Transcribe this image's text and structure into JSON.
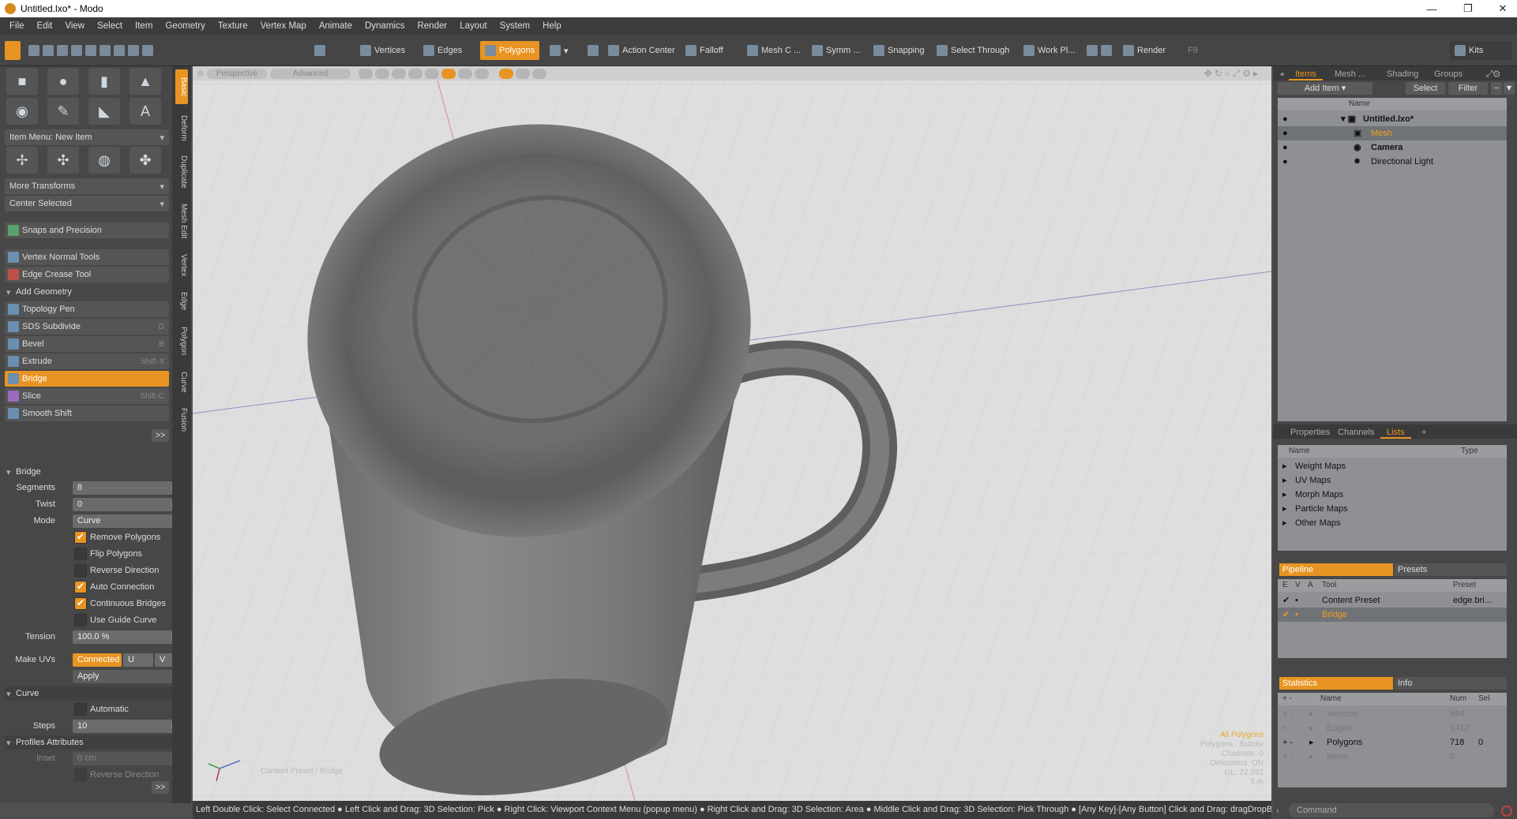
{
  "window": {
    "title": "Untitled.lxo* - Modo"
  },
  "menu": [
    "File",
    "Edit",
    "View",
    "Select",
    "Item",
    "Geometry",
    "Texture",
    "Vertex Map",
    "Animate",
    "Dynamics",
    "Render",
    "Layout",
    "System",
    "Help"
  ],
  "toolbar": {
    "vertices": "Vertices",
    "edges": "Edges",
    "polygons": "Polygons",
    "action_center": "Action Center",
    "falloff": "Falloff",
    "mesh_c": "Mesh C ...",
    "symm": "Symm ...",
    "snapping": "Snapping",
    "select_through": "Select Through",
    "work_pl": "Work Pl...",
    "render": "Render",
    "render_key": "F9",
    "kits": "Kits"
  },
  "left": {
    "item_menu": "Item Menu: New Item",
    "more_transforms": "More Transforms",
    "center_selected": "Center Selected",
    "snaps": "Snaps and Precision",
    "vertex_normal": "Vertex Normal Tools",
    "edge_crease": "Edge Crease Tool",
    "add_geometry": "Add Geometry",
    "tools": [
      {
        "label": "Topology Pen",
        "key": ""
      },
      {
        "label": "SDS Subdivide",
        "key": "D"
      },
      {
        "label": "Bevel",
        "key": "B"
      },
      {
        "label": "Extrude",
        "key": "Shift-X"
      },
      {
        "label": "Bridge",
        "key": ""
      },
      {
        "label": "Slice",
        "key": "Shift-C"
      },
      {
        "label": "Smooth Shift",
        "key": ""
      }
    ],
    "more": ">>",
    "bridge": {
      "title": "Bridge",
      "segments_label": "Segments",
      "segments": "8",
      "twist_label": "Twist",
      "twist": "0",
      "mode_label": "Mode",
      "mode": "Curve",
      "remove_polygons": "Remove Polygons",
      "flip_polygons": "Flip Polygons",
      "reverse_direction": "Reverse Direction",
      "auto_connection": "Auto Connection",
      "continuous_bridges": "Continuous Bridges",
      "use_guide_curve": "Use Guide Curve",
      "tension_label": "Tension",
      "tension": "100.0 %",
      "make_uvs_label": "Make UVs",
      "connected": "Connected",
      "u": "U",
      "v": "V",
      "apply": "Apply",
      "curve": "Curve",
      "automatic": "Automatic",
      "steps_label": "Steps",
      "steps": "10",
      "profiles": "Profiles Attributes",
      "inset_label": "Inset",
      "inset": "0 cm",
      "reverse_direction2": "Reverse Direction"
    }
  },
  "vtabs": [
    "Basic",
    "Deform",
    "Duplicate",
    "Mesh Edit",
    "Vertex",
    "Edge",
    "Polygon",
    "Curve",
    "Fusion"
  ],
  "viewport": {
    "perspective": "Perspective",
    "advanced": "Advanced",
    "content_preset": "Content Preset : Bridge",
    "stats": [
      "All Polygons",
      "Polygons : Subdiv",
      "Channels: 0",
      "Deformers: ON",
      "GL: 22,592",
      "5 m"
    ]
  },
  "status": "Left Double Click: Select Connected ● Left Click and Drag: 3D Selection: Pick ● Right Click: Viewport Context Menu (popup menu) ● Right Click and Drag: 3D Selection: Area ● Middle Click and Drag: 3D Selection: Pick Through ● [Any Key]-[Any Button] Click and Drag: dragDropB ...",
  "right": {
    "tabs": [
      "Items",
      "Mesh ...",
      "Shading",
      "Groups"
    ],
    "add_item": "Add Item",
    "select": "Select",
    "filter": "Filter",
    "name_col": "Name",
    "items": [
      {
        "label": "Untitled.lxo*"
      },
      {
        "label": "Mesh"
      },
      {
        "label": "Camera"
      },
      {
        "label": "Directional Light"
      }
    ],
    "tabs2": [
      "Properties",
      "Channels",
      "Lists"
    ],
    "lists_name": "Name",
    "lists_type": "Type",
    "lists": [
      "Weight Maps",
      "UV Maps",
      "Morph Maps",
      "Particle Maps",
      "Other Maps"
    ],
    "pipeline": "Pipeline",
    "presets": "Presets",
    "pipe_cols": {
      "e": "E",
      "v": "V",
      "a": "A",
      "tool": "Tool",
      "preset": "Preset"
    },
    "pipe_rows": [
      {
        "tool": "Content Preset",
        "preset": "edge.bri..."
      },
      {
        "tool": "Bridge",
        "preset": ""
      }
    ],
    "statistics": "Statistics",
    "info": "Info",
    "stat_cols": {
      "name": "Name",
      "num": "Num",
      "sel": "Sel"
    },
    "stat_rows": [
      {
        "name": "Vertices",
        "num": "694",
        "sel": "..."
      },
      {
        "name": "Edges",
        "num": "1412",
        "sel": "..."
      },
      {
        "name": "Polygons",
        "num": "718",
        "sel": "0"
      },
      {
        "name": "Items",
        "num": "0",
        "sel": "..."
      }
    ],
    "command": "Command"
  }
}
